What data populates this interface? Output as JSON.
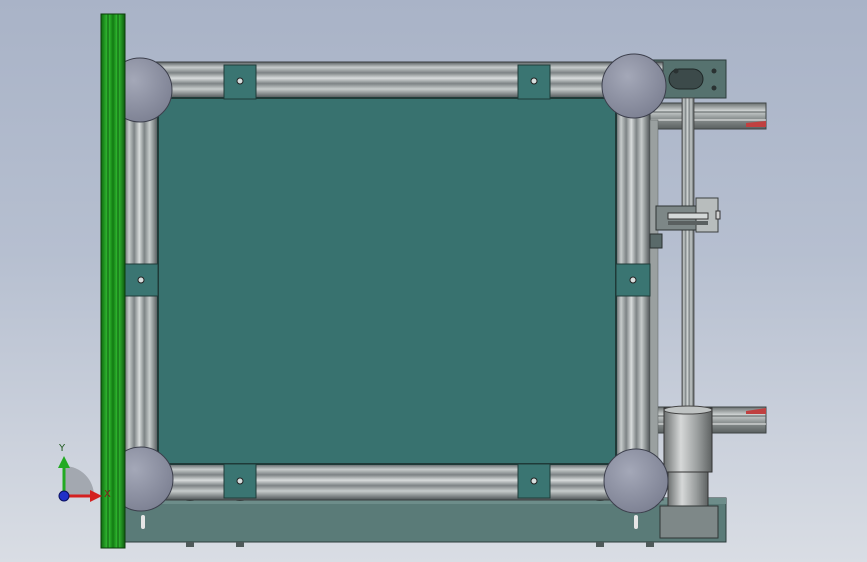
{
  "viewport": {
    "background_top": "#a9b3c7",
    "background_bottom": "#d9dde4"
  },
  "model": {
    "panel_color": "#38726f",
    "extrusion_color": "#8e9596",
    "bracket_color": "#3a7572",
    "rail_color": "#1f9a1f",
    "base_color": "#5a7b78",
    "foot_color": "#8e92a4"
  },
  "triad": {
    "y_label": "Y",
    "x_label": "X",
    "x_color": "#d42020",
    "y_color": "#22aa22",
    "z_color": "#2030c8"
  }
}
